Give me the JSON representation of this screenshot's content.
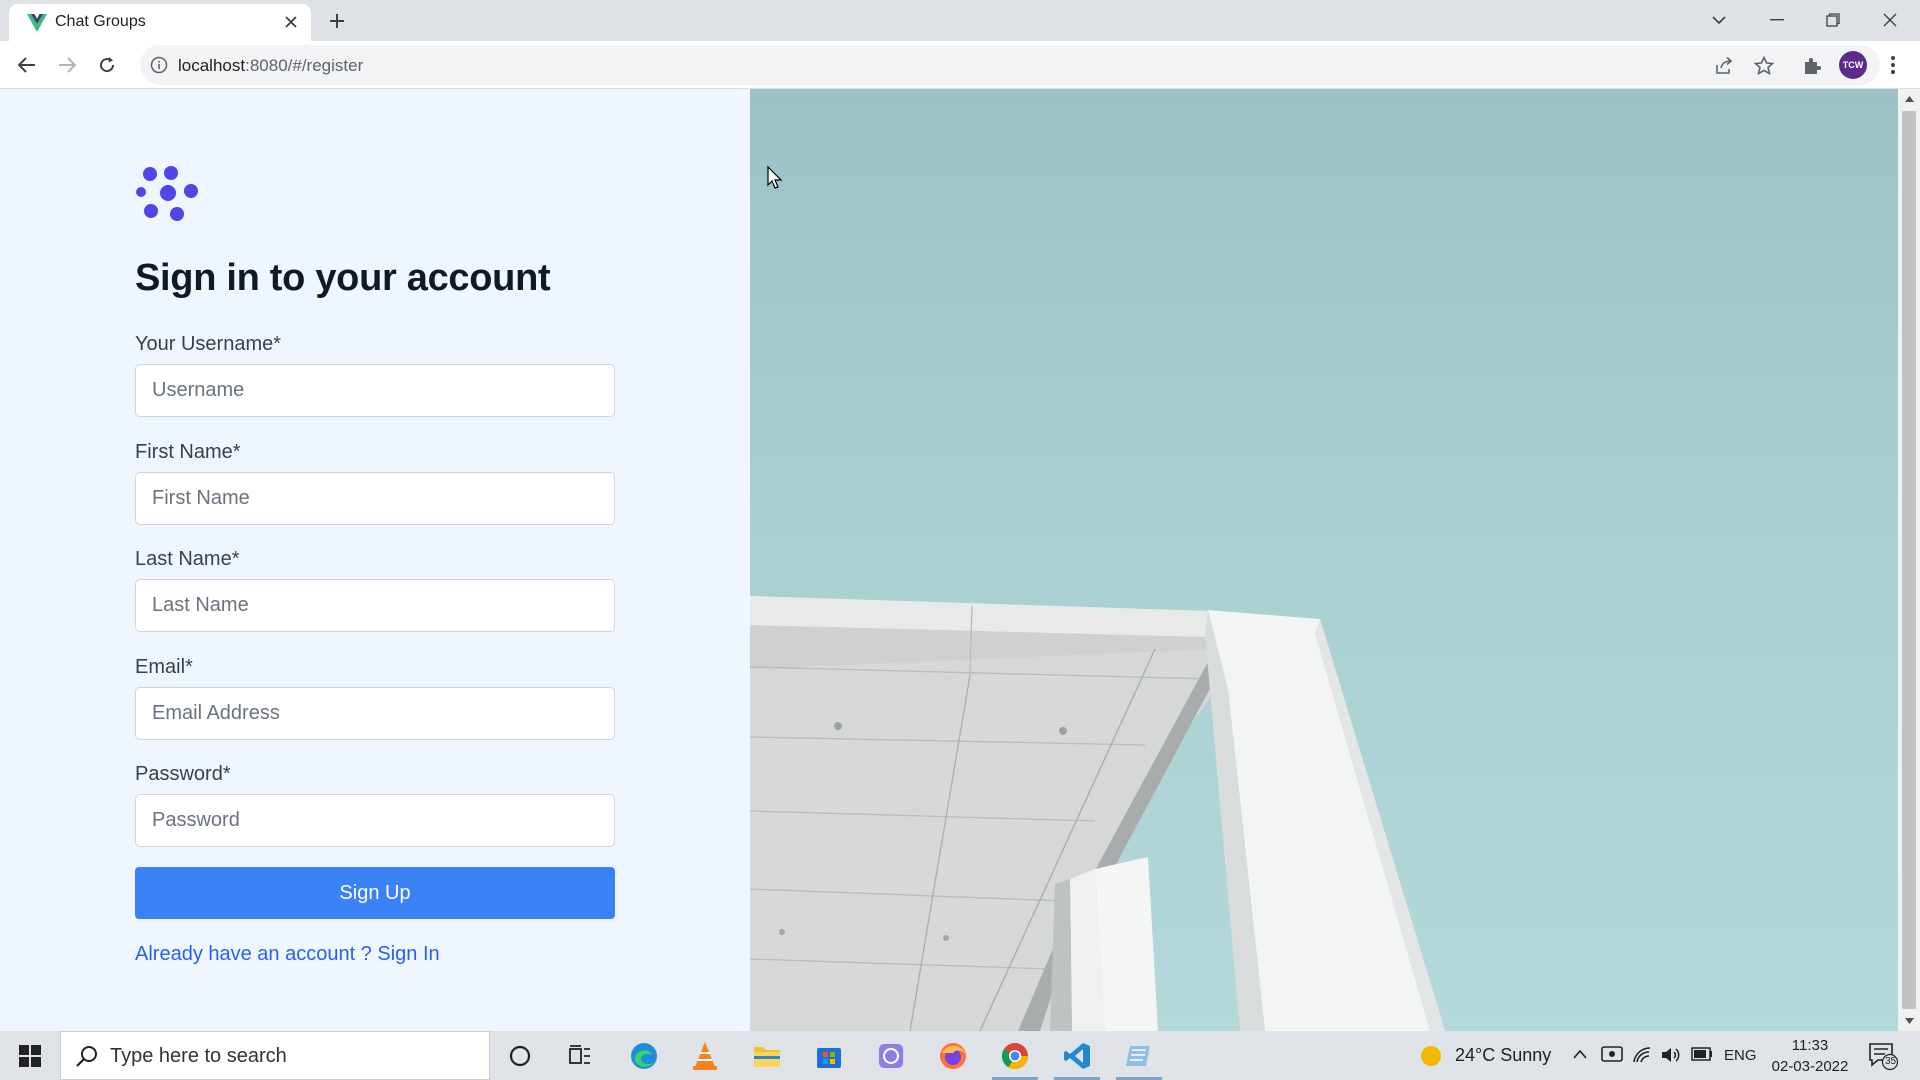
{
  "browser": {
    "tab_title": "Chat Groups",
    "url_host": "localhost",
    "url_rest": ":8080/#/register",
    "profile_initials": "TCW"
  },
  "page": {
    "heading": "Sign in to your account",
    "fields": [
      {
        "label": "Your Username*",
        "placeholder": "Username"
      },
      {
        "label": "First Name*",
        "placeholder": "First Name"
      },
      {
        "label": "Last Name*",
        "placeholder": "Last Name"
      },
      {
        "label": "Email*",
        "placeholder": "Email Address"
      },
      {
        "label": "Password*",
        "placeholder": "Password"
      }
    ],
    "submit_label": "Sign Up",
    "signin_link": "Already have an account ? Sign In"
  },
  "taskbar": {
    "search_placeholder": "Type here to search",
    "weather": "24°C  Sunny",
    "language": "ENG",
    "time": "11:33",
    "date": "02-03-2022",
    "notification_count": "35"
  },
  "colors": {
    "accent": "#3b82f6",
    "link": "#2563eb",
    "left_bg": "#eff6ff",
    "logo": "#4f46e5",
    "sky": "#a9cfd1"
  }
}
